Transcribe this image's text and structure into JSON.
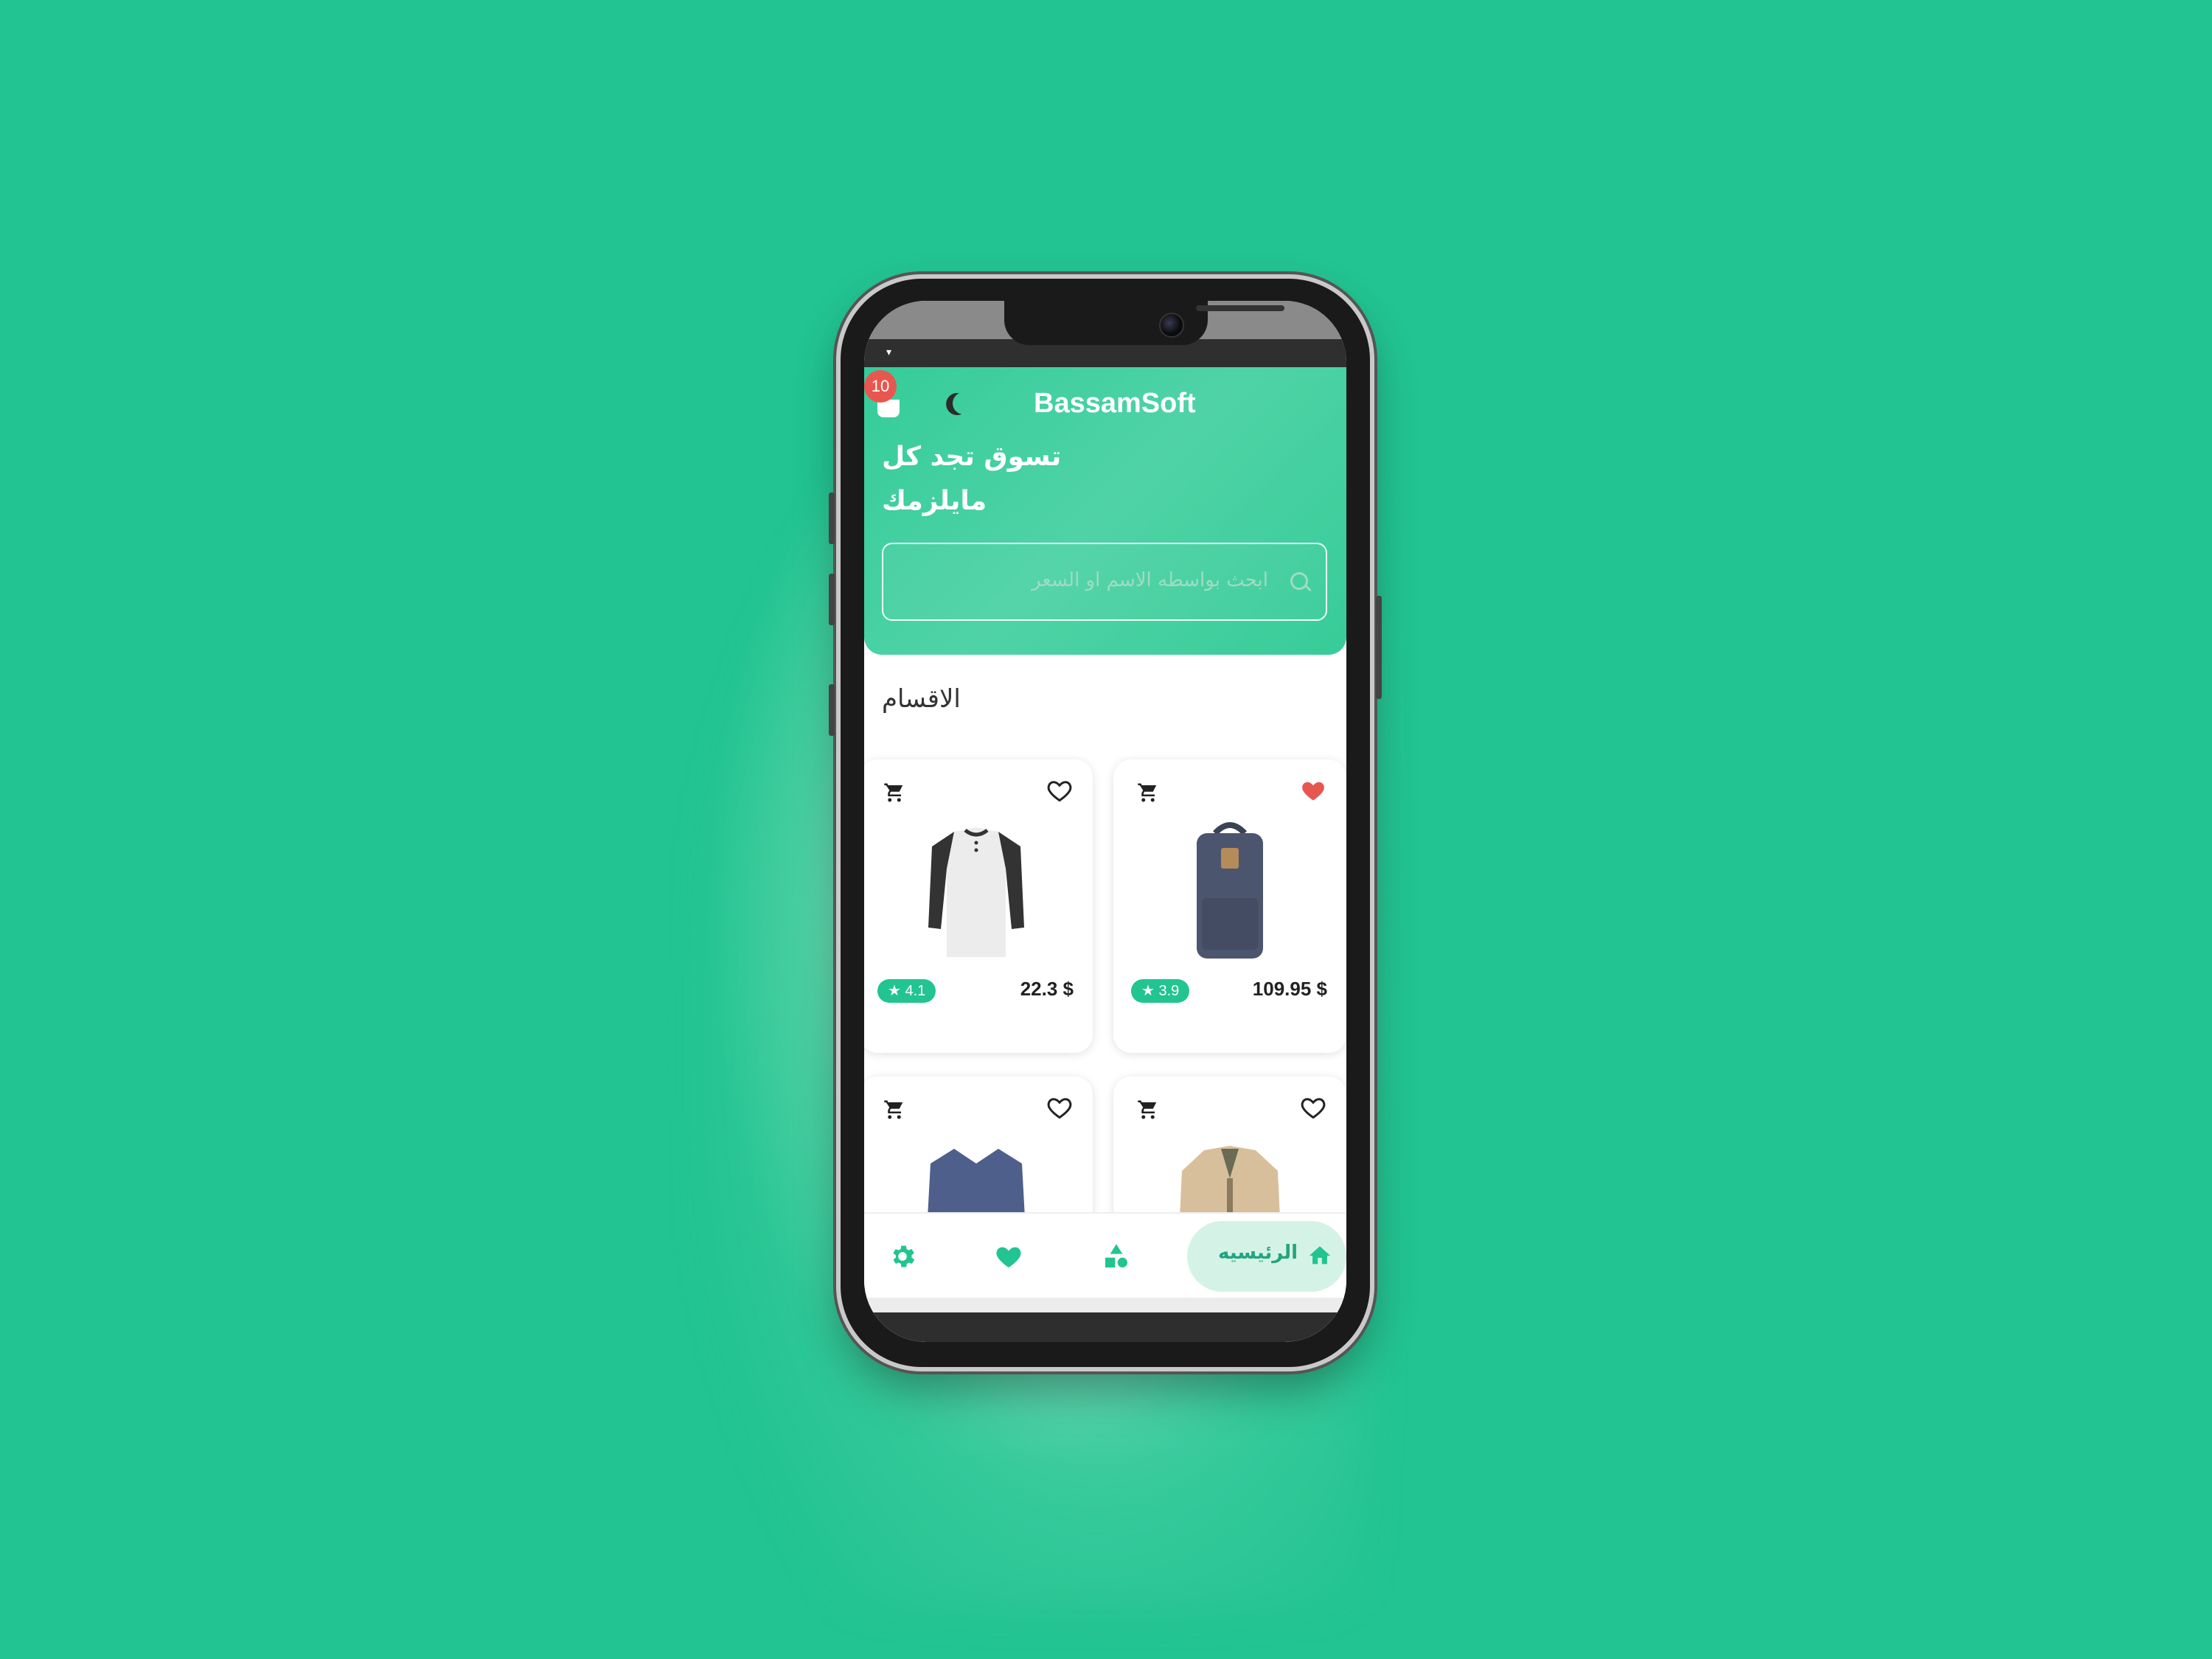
{
  "app": {
    "brand": "BassamSoft",
    "cart_count": "10",
    "headline": "تسوق تجد كل مايلزمك"
  },
  "search": {
    "placeholder": "ابحث بواسطه الاسم او السعر"
  },
  "section": {
    "title": "الاقسام"
  },
  "products": [
    {
      "name": "henley shirt",
      "price": "22.3 $",
      "rating": "★ 4.1",
      "favorite": false
    },
    {
      "name": "backpack",
      "price": "109.95 $",
      "rating": "★ 3.9",
      "favorite": true
    },
    {
      "name": "long sleeve tee",
      "price": "",
      "rating": "",
      "favorite": false
    },
    {
      "name": "jacket",
      "price": "",
      "rating": "",
      "favorite": false
    }
  ],
  "nav": {
    "home_label": "الرئيسيه",
    "items": [
      "settings-icon",
      "heart-icon",
      "categories-icon",
      "home-icon"
    ]
  },
  "colors": {
    "accent": "#22c491",
    "favorite": "#e8574f",
    "badge": "#e8574f"
  }
}
